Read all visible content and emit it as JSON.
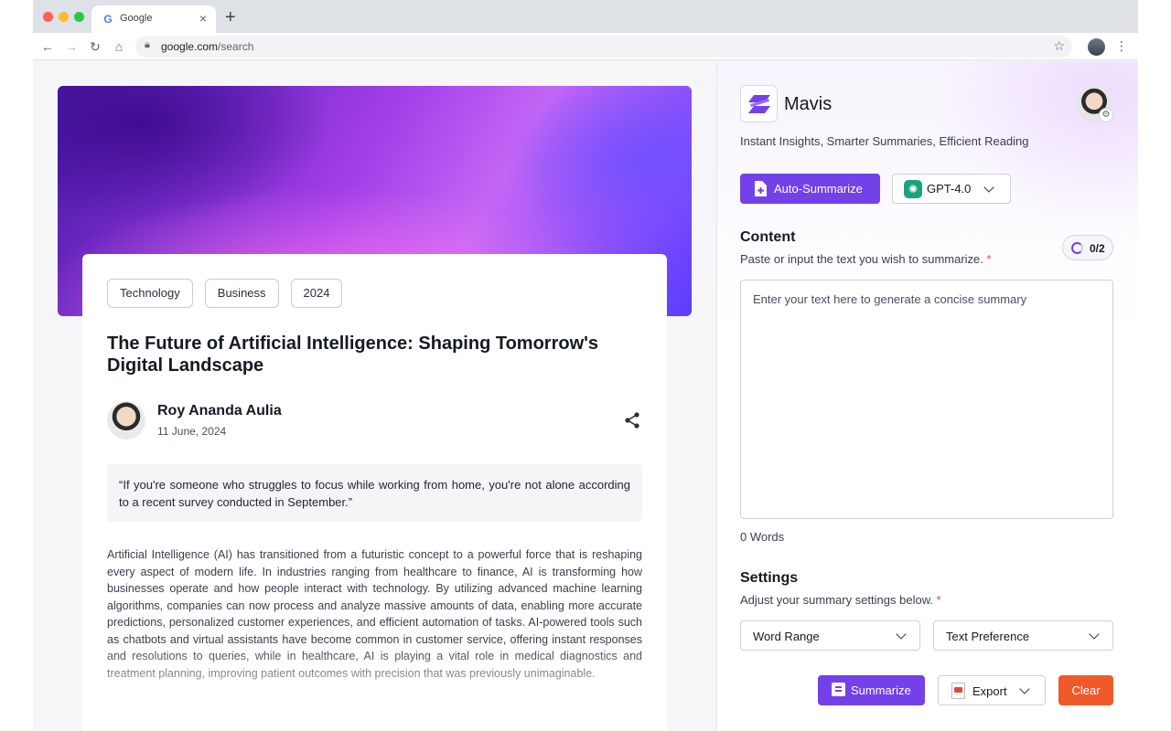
{
  "browser": {
    "tab_title": "Google",
    "tab_favicon": "G",
    "url_host": "google.com",
    "url_path": "/search"
  },
  "article": {
    "tags": [
      "Technology",
      "Business",
      "2024"
    ],
    "headline": "The Future of Artificial Intelligence: Shaping Tomorrow's Digital Landscape",
    "author_name": "Roy Ananda Aulia",
    "author_date": "11 June, 2024",
    "quote": "“If you're someone who struggles to focus while working from home, you're not alone according to a recent survey conducted in September.”",
    "body": "Artificial Intelligence (AI) has transitioned from a futuristic concept to a powerful force that is reshaping every aspect of modern life. In industries ranging from healthcare to finance, AI is transforming how businesses operate and how people interact with technology. By utilizing advanced machine learning algorithms, companies can now process and analyze massive amounts of data, enabling more accurate predictions, personalized customer experiences, and efficient automation of tasks. AI-powered tools such as chatbots and virtual assistants have become common in customer service, offering instant responses and resolutions to queries, while in healthcare, AI is playing a vital role in medical diagnostics and treatment planning, improving patient outcomes with precision that was previously unimaginable."
  },
  "mavis": {
    "title": "Mavis",
    "tagline": "Instant Insights, Smarter Summaries, Efficient Reading",
    "auto_summarize_label": "Auto-Summarize",
    "model_label": "GPT-4.0",
    "content_title": "Content",
    "content_sub": "Paste or input the text you wish to summarize.",
    "required_mark": "*",
    "usage": "0/2",
    "content_placeholder": "Enter your text here to generate a concise summary",
    "word_count": "0 Words",
    "settings_title": "Settings",
    "settings_sub": "Adjust your summary settings below.",
    "word_range_label": "Word Range",
    "text_preference_label": "Text Preference",
    "summarize_label": "Summarize",
    "export_label": "Export",
    "clear_label": "Clear"
  },
  "colors": {
    "accent": "#7440e8",
    "danger": "#f05a2a",
    "required": "#e0483b"
  }
}
